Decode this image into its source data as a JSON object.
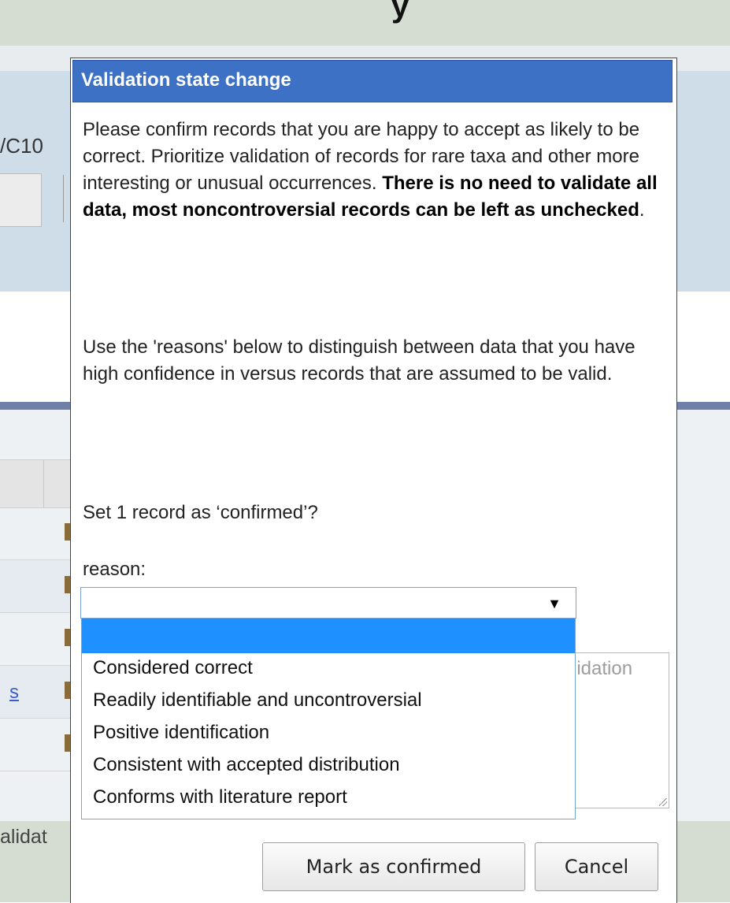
{
  "background": {
    "top_glyph": "y",
    "partial_text": "/C10",
    "grid_link": "s",
    "bottom_text": "alidat"
  },
  "dialog": {
    "title": "Validation state change",
    "message_plain": "Please confirm records that you are happy to accept as likely to be correct. Prioritize validation of records for rare taxa and other more interesting or unusual occurrences. ",
    "message_bold": "There is no need to validate all data, most noncontroversial records can be left as unchecked",
    "message_end": ".",
    "message2": "Use the 'reasons' below to distinguish between data that you have high confidence in versus records that are assumed to be valid.",
    "question": "Set 1 record as ‘confirmed’?",
    "reason_label": "reason:",
    "reason_select": {
      "value": "",
      "arrow_icon": "triangle-down-icon",
      "options": [
        "",
        "Considered correct",
        "Readily identifiable and uncontroversial",
        "Positive identification",
        "Consistent with accepted distribution",
        "Conforms with literature report"
      ],
      "highlight_color": "#1e90ff"
    },
    "comment_placeholder_fragment": "lidation",
    "confirm_button": "Mark as confirmed",
    "cancel_button": "Cancel",
    "titlebar_color": "#3d71c6"
  }
}
